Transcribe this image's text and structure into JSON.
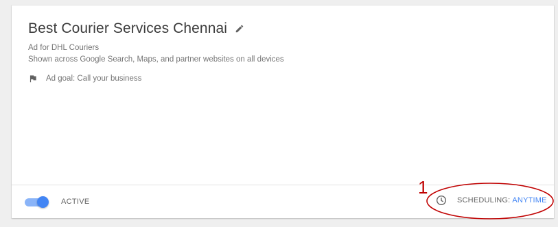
{
  "campaign": {
    "title": "Best Courier Services Chennai",
    "ad_for": "Ad for DHL Couriers",
    "shown_across": "Shown across Google Search, Maps, and partner websites on all devices",
    "goal": "Ad goal: Call your business"
  },
  "footer": {
    "status_label": "ACTIVE",
    "toggle_on": true,
    "scheduling_label": "SCHEDULING:",
    "scheduling_value": "ANYTIME"
  },
  "annotation": {
    "number": "1"
  },
  "icons": {
    "edit": "pencil-icon",
    "goal": "flag-icon",
    "schedule": "clock-icon"
  },
  "colors": {
    "accent": "#4285f4",
    "toggle_track": "#8ab4f8",
    "annotation": "#c00000"
  }
}
